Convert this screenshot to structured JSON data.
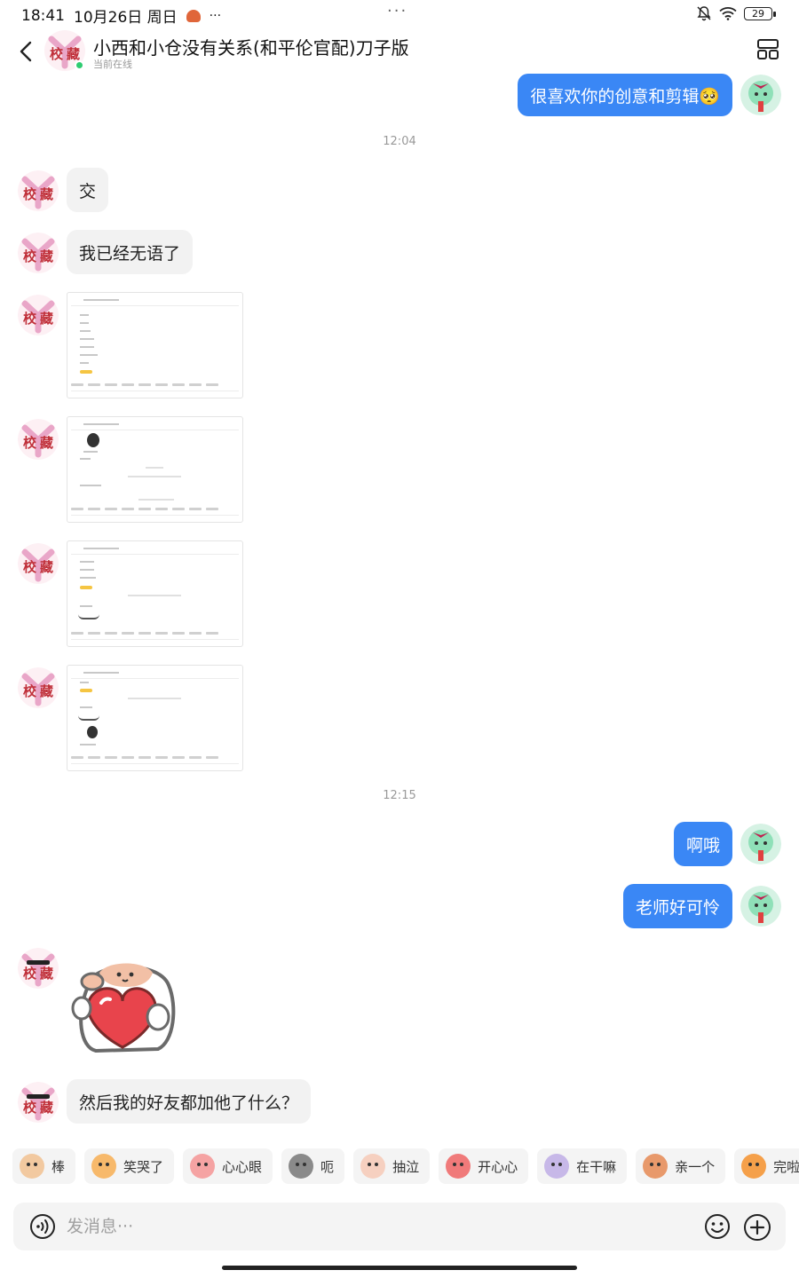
{
  "status_bar": {
    "time": "18:41",
    "date": "10月26日 周日",
    "more_dots": "···",
    "center_dots": "···",
    "battery": "29"
  },
  "header": {
    "title": "小西和小仓没有关系(和平伦官配)刀子版",
    "subtitle": "当前在线",
    "back_icon": "back-arrow-icon",
    "layout_icon": "layout-grid-icon"
  },
  "messages": [
    {
      "side": "out",
      "text": "很喜欢你的创意和剪辑🥺"
    },
    {
      "type": "time",
      "text": "12:04"
    },
    {
      "side": "in",
      "text": "交"
    },
    {
      "side": "in",
      "text": "我已经无语了"
    },
    {
      "side": "in",
      "type": "image",
      "label": "screenshot-1"
    },
    {
      "side": "in",
      "type": "image",
      "label": "screenshot-2"
    },
    {
      "side": "in",
      "type": "image",
      "label": "screenshot-3"
    },
    {
      "side": "in",
      "type": "image",
      "label": "screenshot-4"
    },
    {
      "type": "time",
      "text": "12:15"
    },
    {
      "side": "out",
      "text": "啊哦"
    },
    {
      "side": "out",
      "text": "老师好可怜"
    },
    {
      "side": "in",
      "type": "sticker",
      "label": "heart-hug-sticker"
    },
    {
      "side": "in",
      "text": "然后我的好友都加他了什么？"
    }
  ],
  "quick_reactions": [
    {
      "label": "棒",
      "color": "#f2c9a0"
    },
    {
      "label": "笑哭了",
      "color": "#f7b96b"
    },
    {
      "label": "心心眼",
      "color": "#f5a3a3"
    },
    {
      "label": "呃",
      "color": "#8a8a8a"
    },
    {
      "label": "抽泣",
      "color": "#f6d0c0"
    },
    {
      "label": "开心心",
      "color": "#f07a7a"
    },
    {
      "label": "在干嘛",
      "color": "#c7b8e8"
    },
    {
      "label": "亲一个",
      "color": "#e8996b"
    },
    {
      "label": "完啦",
      "color": "#f5a04a"
    }
  ],
  "input": {
    "placeholder": "发消息···"
  },
  "colors": {
    "accent": "#3a87f5",
    "incoming_bubble": "#f2f2f2",
    "online": "#2ecc71"
  }
}
